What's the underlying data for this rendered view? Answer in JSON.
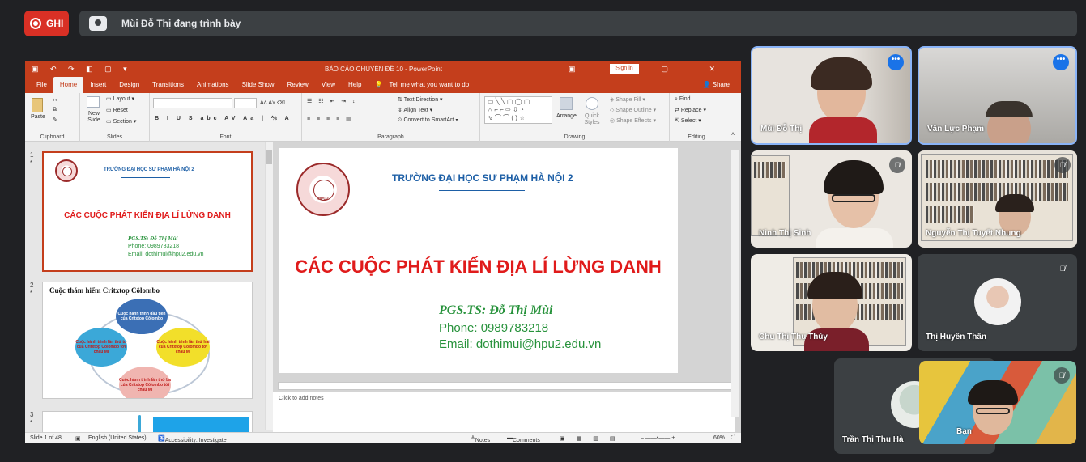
{
  "recording": {
    "label": "GHI"
  },
  "presenting": {
    "text": "Mùi Đỗ Thị đang trình bày"
  },
  "ppt": {
    "window_title": "BÁO CÁO CHUYÊN ĐỀ 10 - PowerPoint",
    "sign_in": "Sign in",
    "tabs": [
      "File",
      "Home",
      "Insert",
      "Design",
      "Transitions",
      "Animations",
      "Slide Show",
      "Review",
      "View",
      "Help"
    ],
    "tell_me": "Tell me what you want to do",
    "share": "Share",
    "ribbon": {
      "clipboard": {
        "label": "Clipboard",
        "paste": "Paste"
      },
      "slides": {
        "label": "Slides",
        "new_slide": "New Slide",
        "layout": "Layout",
        "reset": "Reset",
        "section": "Section"
      },
      "font": {
        "label": "Font"
      },
      "paragraph": {
        "label": "Paragraph",
        "text_direction": "Text Direction",
        "align_text": "Align Text",
        "convert": "Convert to SmartArt"
      },
      "drawing": {
        "label": "Drawing",
        "arrange": "Arrange",
        "quick_styles": "Quick Styles",
        "shape_fill": "Shape Fill",
        "shape_outline": "Shape Outline",
        "shape_effects": "Shape Effects"
      },
      "editing": {
        "label": "Editing",
        "find": "Find",
        "replace": "Replace",
        "select": "Select"
      }
    },
    "thumbnails": [
      {
        "num": "1",
        "school": "TRƯỜNG ĐẠI HỌC SƯ PHẠM HÀ NỘI 2",
        "title": "CÁC CUỘC PHÁT KIẾN ĐỊA LÍ LỪNG DANH",
        "author": "PGS.TS: Đỗ Thị Mùi",
        "phone": "Phone: 0989783218",
        "email": "Email: dothimui@hpu2.edu.vn"
      },
      {
        "num": "2",
        "title": "Cuộc thám hiểm Critxtop Côlombo",
        "b1": "Cuộc hành trình đầu tiên của Critxtop Côlombo",
        "b2": "Cuộc hành trình lần thứ hai của Critxtop Côlombo tới châu Mĩ",
        "b3": "Cuộc hành trình lần thứ ba của Critxtop Côlombo tới châu Mĩ",
        "b4": "Cuộc hành trình lần thứ tư của Critxtop Côlombo tới châu Mĩ"
      },
      {
        "num": "3"
      }
    ],
    "slide": {
      "school": "TRƯỜNG ĐẠI HỌC SƯ PHẠM HÀ NỘI 2",
      "title": "CÁC CUỘC PHÁT KIẾN ĐỊA LÍ LỪNG DANH",
      "author": "PGS.TS: Đỗ Thị Mùi",
      "phone": "Phone: 0989783218",
      "email": "Email: dothimui@hpu2.edu.vn",
      "logo_text": "HPU2"
    },
    "notes_placeholder": "Click to add notes",
    "status": {
      "slide": "Slide 1 of 48",
      "language": "English (United States)",
      "accessibility": "Accessibility: Investigate",
      "notes": "Notes",
      "comments": "Comments",
      "zoom": "60%"
    }
  },
  "participants": [
    {
      "name": "Mùi Đỗ Thị"
    },
    {
      "name": "Văn Lực Phạm"
    },
    {
      "name": "Ninh Thị Sinh"
    },
    {
      "name": "Nguyễn Thị Tuyết Nhung"
    },
    {
      "name": "Chu Thị Thu Thủy"
    },
    {
      "name": "Thị Huyền Thân"
    },
    {
      "name": "Trần Thị Thu Hà"
    },
    {
      "name": "Bạn"
    }
  ],
  "colors": {
    "record": "#d93025",
    "ppt_accent": "#c43e1c",
    "speaker_border": "#8ab4f8",
    "meet_bg": "#202124"
  }
}
